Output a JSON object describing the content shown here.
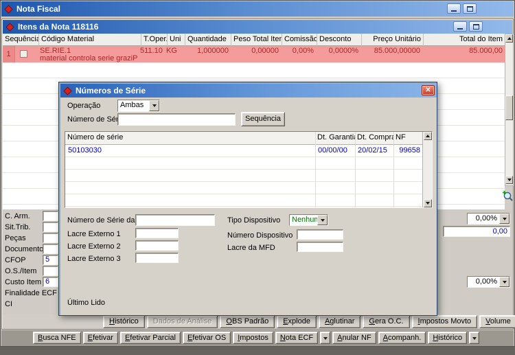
{
  "icons": {
    "close": "✕"
  },
  "colors": {
    "titlebar_blue": "#1f57ae",
    "selected_row_pink": "#f49c9c",
    "selected_row_text": "#a82828",
    "value_blue": "#0000c0",
    "value_green": "#007800",
    "dialog_frame": "#8fadc8"
  },
  "main_window": {
    "title": "Nota Fiscal",
    "toolbar": [
      "Busca NFE",
      "Efetivar",
      "Efetivar Parcial",
      "Efetivar OS",
      "Impostos",
      "Nota ECF",
      "Anular NF",
      "Acompanh.",
      "Histórico"
    ]
  },
  "items_window": {
    "title": "Itens da Nota 118116",
    "columns": [
      "Sequência",
      "Código Material",
      "T.Oper.",
      "Uni",
      "Quantidade",
      "Peso Total Item",
      "Comissão",
      "Desconto",
      "Preço Unitário",
      "Total do Item"
    ],
    "row": {
      "seq": "1",
      "code": "SE.RIE.1",
      "description": "material controla serie graziP",
      "toper": "511.10",
      "uni": "KG",
      "qty": "1,000000",
      "peso": "0,00000",
      "comissao": "0,00%",
      "desconto": "0,0000%",
      "preco_unitario": "85.000,00000",
      "total": "85.000,00"
    },
    "form_labels": [
      "C. Arm.",
      "Sit.Trib.",
      "Peças",
      "Documento",
      "CFOP",
      "O.S./Item",
      "Custo Item",
      "Finalidade ECF",
      "CI"
    ],
    "form_fragments": {
      "cfop": "5",
      "custo_item": "6"
    },
    "right_fields": {
      "percent_top": "0,00%",
      "amount": "0,00",
      "percent_bottom": "0,00%"
    },
    "buttons": [
      "Histórico",
      "Dados de Análise",
      "OBS Padrão",
      "Explode",
      "Aglutinar",
      "Gera O.C.",
      "Impostos Movto",
      "Volume"
    ]
  },
  "serial_dialog": {
    "title": "Números de Série",
    "operacao_label": "Operação",
    "operacao_value": "Ambas",
    "numero_serie_label": "Número de Série",
    "sequencia_button": "Sequência",
    "grid": {
      "columns": [
        "Número de série",
        "Dt. Garantia",
        "Dt. Compra",
        "NF"
      ],
      "row": {
        "serial": "50103030",
        "garantia": "00/00/00",
        "compra": "20/02/15",
        "nf": "99658"
      }
    },
    "fields": {
      "mfd_label": "Número de Série da MFD",
      "tipo_dispositivo_label": "Tipo Dispositivo",
      "tipo_dispositivo_value": "Nenhum",
      "lacre_externo_1_label": "Lacre Externo 1",
      "numero_dispositivo_label": "Número Dispositivo",
      "lacre_externo_2_label": "Lacre Externo 2",
      "lacre_mfd_label": "Lacre da MFD",
      "lacre_externo_3_label": "Lacre Externo 3",
      "ultimo_lido_label": "Último Lido"
    }
  }
}
